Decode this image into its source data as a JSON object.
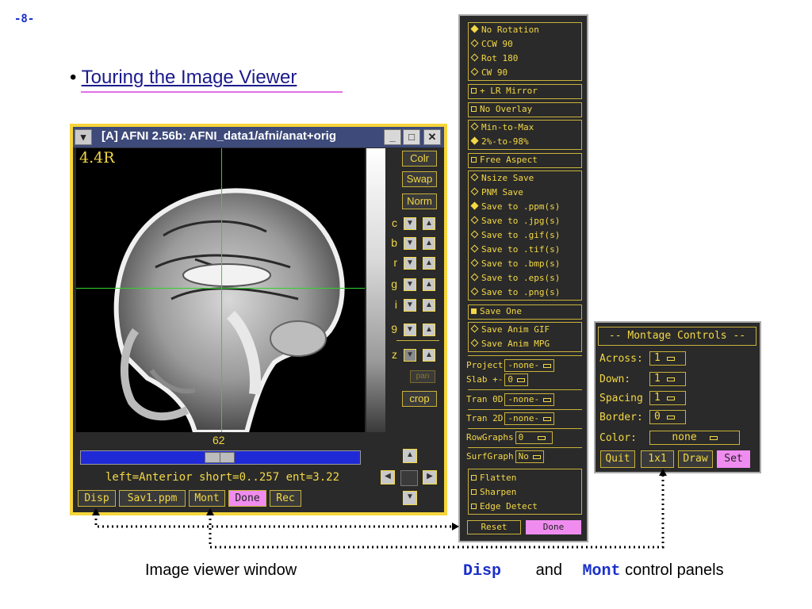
{
  "slide": {
    "number": "-8-",
    "bullet": "•",
    "title": "Touring the Image Viewer"
  },
  "viewer": {
    "title": "[A] AFNI 2.56b: AFNI_data1/afni/anat+orig",
    "orientation_label": "4.4R",
    "slice_number": "62",
    "info_text": "left=Anterior short=0..257 ent=3.22",
    "side_buttons": [
      "Colr",
      "Swap",
      "Norm"
    ],
    "arrow_labels": [
      "c",
      "b",
      "r",
      "g",
      "i",
      "9",
      "z"
    ],
    "pan_label": "pan",
    "crop_label": "crop",
    "bottom_buttons": [
      "Disp",
      "Sav1.ppm",
      "Mont",
      "Done",
      "Rec"
    ],
    "slider_position": 0.49
  },
  "disp_panel": {
    "rotation": [
      "No Rotation",
      "CCW 90",
      "Rot 180",
      "CW 90"
    ],
    "rotation_selected": 0,
    "lr_mirror": "+ LR Mirror",
    "no_overlay": "No Overlay",
    "range": [
      "Min-to-Max",
      "2%-to-98%"
    ],
    "range_selected": 1,
    "free_aspect": "Free Aspect",
    "save_formats": [
      "Nsize Save",
      "PNM Save",
      "Save to .ppm(s)",
      "Save to .jpg(s)",
      "Save to .gif(s)",
      "Save to .tif(s)",
      "Save to .bmp(s)",
      "Save to .eps(s)",
      "Save to .png(s)"
    ],
    "save_selected": 2,
    "save_one": "Save One",
    "anim": [
      "Save Anim GIF",
      "Save Anim MPG"
    ],
    "project_label": "Project",
    "project_value": "-none-",
    "slab_label": "Slab +-",
    "slab_value": "0",
    "tran0d_label": "Tran 0D",
    "tran0d_value": "-none-",
    "tran2d_label": "Tran 2D",
    "tran2d_value": "-none-",
    "rowgraphs_label": "RowGraphs",
    "rowgraphs_value": "0",
    "surfgraph_label": "SurfGraph",
    "surfgraph_value": "No",
    "filters": [
      "Flatten",
      "Sharpen",
      "Edge Detect"
    ],
    "reset_label": "Reset",
    "done_label": "Done"
  },
  "montage": {
    "title": "-- Montage Controls --",
    "across_label": "Across:",
    "across_value": "1",
    "down_label": "Down:",
    "down_value": "1",
    "spacing_label": "Spacing",
    "spacing_value": "1",
    "border_label": "Border:",
    "border_value": "0",
    "color_label": "Color:",
    "color_value": "none",
    "buttons": [
      "Quit",
      "1x1",
      "Draw",
      "Set"
    ]
  },
  "captions": {
    "viewer": "Image viewer window",
    "disp_code": "Disp",
    "and": "and",
    "mont_code": "Mont",
    "panels": "control panels"
  },
  "colors": {
    "accent_yellow": "#f3d845",
    "panel_bg": "#2a2a2a",
    "highlight_pink": "#f08cf0",
    "slider_blue": "#1f2ad6",
    "code_blue": "#1a2fc9"
  }
}
